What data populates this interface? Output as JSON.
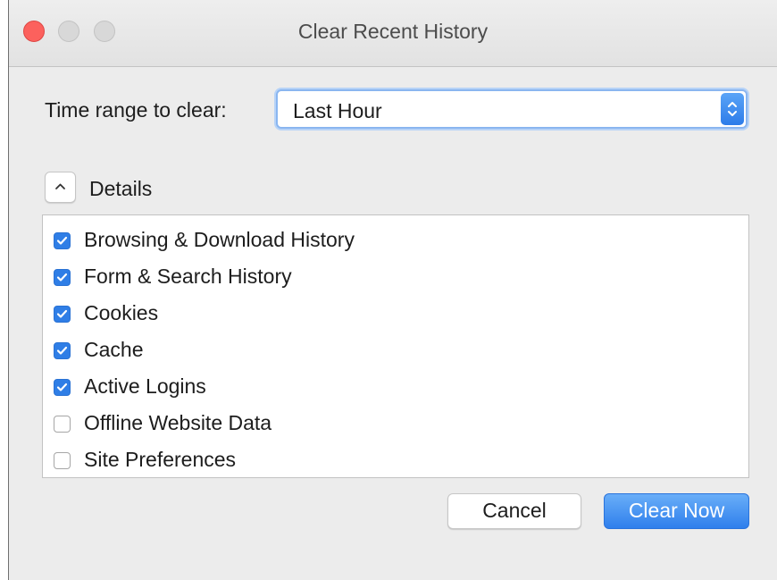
{
  "window": {
    "title": "Clear Recent History"
  },
  "time_range": {
    "label": "Time range to clear:",
    "selected": "Last Hour"
  },
  "details": {
    "label": "Details",
    "expanded": true
  },
  "items": [
    {
      "label": "Browsing & Download History",
      "checked": true
    },
    {
      "label": "Form & Search History",
      "checked": true
    },
    {
      "label": "Cookies",
      "checked": true
    },
    {
      "label": "Cache",
      "checked": true
    },
    {
      "label": "Active Logins",
      "checked": true
    },
    {
      "label": "Offline Website Data",
      "checked": false
    },
    {
      "label": "Site Preferences",
      "checked": false
    }
  ],
  "buttons": {
    "cancel": "Cancel",
    "clear": "Clear Now"
  },
  "colors": {
    "accent": "#2f7ee6",
    "close": "#fc615d"
  }
}
